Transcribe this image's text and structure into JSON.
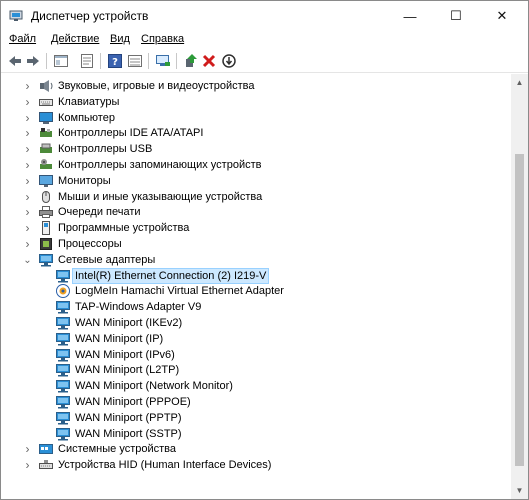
{
  "window": {
    "title": "Диспетчер устройств",
    "minimize_glyph": "—",
    "maximize_glyph": "☐",
    "close_glyph": "✕"
  },
  "menu": [
    {
      "label": "Файл"
    },
    {
      "label": "Действие"
    },
    {
      "label": "Вид"
    },
    {
      "label": "Справка"
    }
  ],
  "toolbar": [
    {
      "name": "back-icon"
    },
    {
      "name": "forward-icon"
    },
    {
      "name": "properties-pane-icon"
    },
    {
      "name": "properties-icon"
    },
    {
      "name": "help-icon"
    },
    {
      "name": "view-icon"
    },
    {
      "name": "scan-hardware-icon"
    },
    {
      "name": "update-driver-icon"
    },
    {
      "name": "uninstall-icon"
    },
    {
      "name": "disable-icon"
    }
  ],
  "tree": [
    {
      "label": "Звуковые, игровые и видеоустройства",
      "icon": "sound-icon",
      "expander": "›",
      "level": 0
    },
    {
      "label": "Клавиатуры",
      "icon": "keyboard-icon",
      "expander": "›",
      "level": 0
    },
    {
      "label": "Компьютер",
      "icon": "computer-icon",
      "expander": "›",
      "level": 0
    },
    {
      "label": "Контроллеры IDE ATA/ATAPI",
      "icon": "ide-controller-icon",
      "expander": "›",
      "level": 0
    },
    {
      "label": "Контроллеры USB",
      "icon": "usb-controller-icon",
      "expander": "›",
      "level": 0
    },
    {
      "label": "Контроллеры запоминающих устройств",
      "icon": "storage-controller-icon",
      "expander": "›",
      "level": 0
    },
    {
      "label": "Мониторы",
      "icon": "monitor-icon",
      "expander": "›",
      "level": 0
    },
    {
      "label": "Мыши и иные указывающие устройства",
      "icon": "mouse-icon",
      "expander": "›",
      "level": 0
    },
    {
      "label": "Очереди печати",
      "icon": "printer-icon",
      "expander": "›",
      "level": 0
    },
    {
      "label": "Программные устройства",
      "icon": "software-device-icon",
      "expander": "›",
      "level": 0
    },
    {
      "label": "Процессоры",
      "icon": "processor-icon",
      "expander": "›",
      "level": 0
    },
    {
      "label": "Сетевые адаптеры",
      "icon": "network-adapter-icon",
      "expander": "⌄",
      "level": 0
    },
    {
      "label": "Intel(R) Ethernet Connection (2) I219-V",
      "icon": "network-adapter-icon",
      "expander": "",
      "level": 1,
      "selected": true
    },
    {
      "label": "LogMeIn Hamachi Virtual Ethernet Adapter",
      "icon": "hamachi-adapter-icon",
      "expander": "",
      "level": 1
    },
    {
      "label": "TAP-Windows Adapter V9",
      "icon": "network-adapter-icon",
      "expander": "",
      "level": 1
    },
    {
      "label": "WAN Miniport (IKEv2)",
      "icon": "network-adapter-icon",
      "expander": "",
      "level": 1
    },
    {
      "label": "WAN Miniport (IP)",
      "icon": "network-adapter-icon",
      "expander": "",
      "level": 1
    },
    {
      "label": "WAN Miniport (IPv6)",
      "icon": "network-adapter-icon",
      "expander": "",
      "level": 1
    },
    {
      "label": "WAN Miniport (L2TP)",
      "icon": "network-adapter-icon",
      "expander": "",
      "level": 1
    },
    {
      "label": "WAN Miniport (Network Monitor)",
      "icon": "network-adapter-icon",
      "expander": "",
      "level": 1
    },
    {
      "label": "WAN Miniport (PPPOE)",
      "icon": "network-adapter-icon",
      "expander": "",
      "level": 1
    },
    {
      "label": "WAN Miniport (PPTP)",
      "icon": "network-adapter-icon",
      "expander": "",
      "level": 1
    },
    {
      "label": "WAN Miniport (SSTP)",
      "icon": "network-adapter-icon",
      "expander": "",
      "level": 1
    },
    {
      "label": "Системные устройства",
      "icon": "system-device-icon",
      "expander": "›",
      "level": 0
    },
    {
      "label": "Устройства HID (Human Interface Devices)",
      "icon": "hid-device-icon",
      "expander": "›",
      "level": 0
    }
  ],
  "colors": {
    "selection_bg": "#cce8ff",
    "selection_border": "#99d1ff",
    "adapter_blue": "#2a8fd6"
  }
}
